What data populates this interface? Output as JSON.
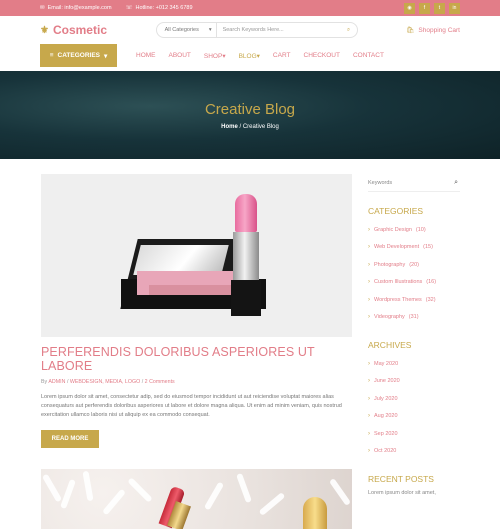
{
  "topbar": {
    "email": "Email: info@example.com",
    "hotline": "Hotline: +012 345 6789",
    "socials": [
      "rss-icon",
      "facebook-icon",
      "twitter-icon",
      "linkedin-icon"
    ]
  },
  "header": {
    "logo_text": "Cosmetic",
    "category_select": "All Categories",
    "search_placeholder": "Search Keywords Here...",
    "cart_label": "Shopping Cart"
  },
  "nav": {
    "categories_label": "CATEGORIES",
    "items": [
      "HOME",
      "ABOUT",
      "SHOP",
      "BLOG",
      "CART",
      "CHECKOUT",
      "CONTACT"
    ],
    "active": "BLOG"
  },
  "hero": {
    "title": "Creative Blog",
    "crumb_home": "Home",
    "crumb_current": "Creative Blog"
  },
  "post": {
    "title": "PERFERENDIS DOLORIBUS ASPERIORES UT LABORE",
    "meta_by": "By",
    "meta_author": "ADMIN",
    "meta_cats": "WEBDESIGN, MEDIA, LOGO",
    "meta_comments": "2 Comments",
    "excerpt": "Lorem ipsum dolor sit amet, consectetur adip, sed do eiusmod tempor incididunt ut aut reiciendise voluptat maiores alias consequaturs aut perferendis doloribus asperiores ut labore et dolore magna aliqua. Ut enim ad minim veniam, quis nostrud exercitation ullamco laboris nisi ut aliquip ex ea commodo consequat.",
    "read_more": "READ MORE"
  },
  "sidebar": {
    "search_placeholder": "Keywords",
    "categories_heading": "CATEGORIES",
    "categories": [
      {
        "name": "Graphic Design",
        "count": "(10)"
      },
      {
        "name": "Web Development",
        "count": "(15)"
      },
      {
        "name": "Photography",
        "count": "(20)"
      },
      {
        "name": "Custom Illustrations",
        "count": "(16)"
      },
      {
        "name": "Wordpress Themes",
        "count": "(32)"
      },
      {
        "name": "Videography",
        "count": "(31)"
      }
    ],
    "archives_heading": "ARCHIVES",
    "archives": [
      "May 2020",
      "June 2020",
      "July 2020",
      "Aug 2020",
      "Sep 2020",
      "Oct 2020"
    ],
    "recent_heading": "RECENT POSTS",
    "recent_text": "Lorem ipsum dolor sit amet,"
  },
  "colors": {
    "primary": "#e27d88",
    "accent": "#c7a84b",
    "hero_bg": "#17333a"
  }
}
